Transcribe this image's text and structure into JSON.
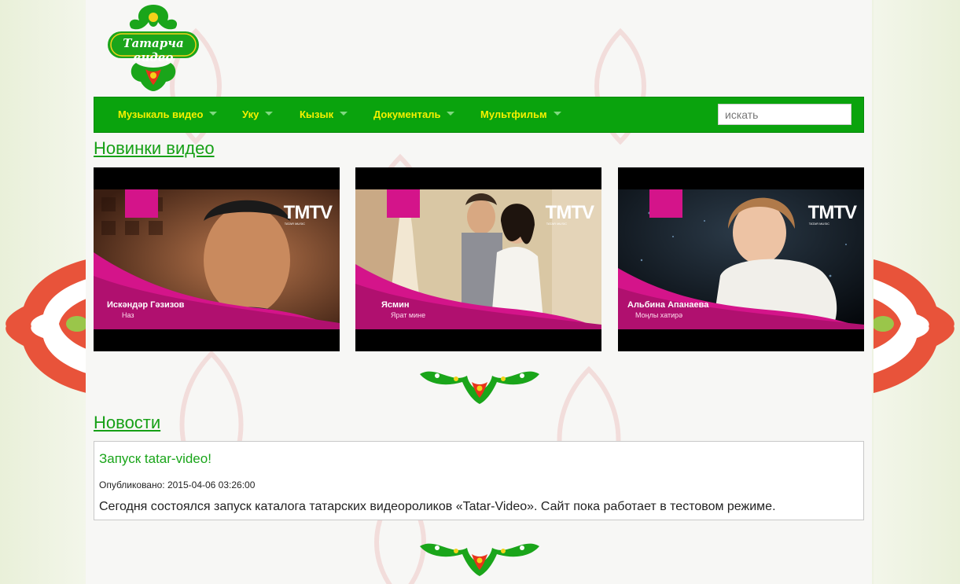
{
  "site": {
    "logo_text": "Татарча видео"
  },
  "nav": {
    "items": [
      {
        "label": "Музыкаль видео"
      },
      {
        "label": "Уку"
      },
      {
        "label": "Кызык"
      },
      {
        "label": "Документаль"
      },
      {
        "label": "Мультфильм"
      }
    ],
    "search_placeholder": "искать"
  },
  "new_videos": {
    "heading": "Новинки видео",
    "videos": [
      {
        "artist": "Искәндәр Гәзизов",
        "song": "Наз",
        "channel": "TMTV",
        "channel_sub": "TATAR MUSIC"
      },
      {
        "artist": "Ясмин",
        "song": "Ярат мине",
        "channel": "TMTV",
        "channel_sub": "TATAR MUSIC"
      },
      {
        "artist": "Альбина Апанаева",
        "song": "Моңлы хатирә",
        "channel": "TMTV",
        "channel_sub": "TATAR MUSIC"
      }
    ]
  },
  "news": {
    "heading": "Новости",
    "items": [
      {
        "title": "Запуск tatar-video!",
        "published": "Опубликовано: 2015-04-06 03:26:00",
        "body": "Сегодня состоялся запуск каталога татарских видеороликов «Tatar-Video». Сайт пока работает в тестовом режиме."
      }
    ]
  },
  "colors": {
    "brand_green": "#0aa30d",
    "nav_text": "#f5f000",
    "heading_green": "#16a016",
    "tmtv_pink": "#d4148a"
  }
}
